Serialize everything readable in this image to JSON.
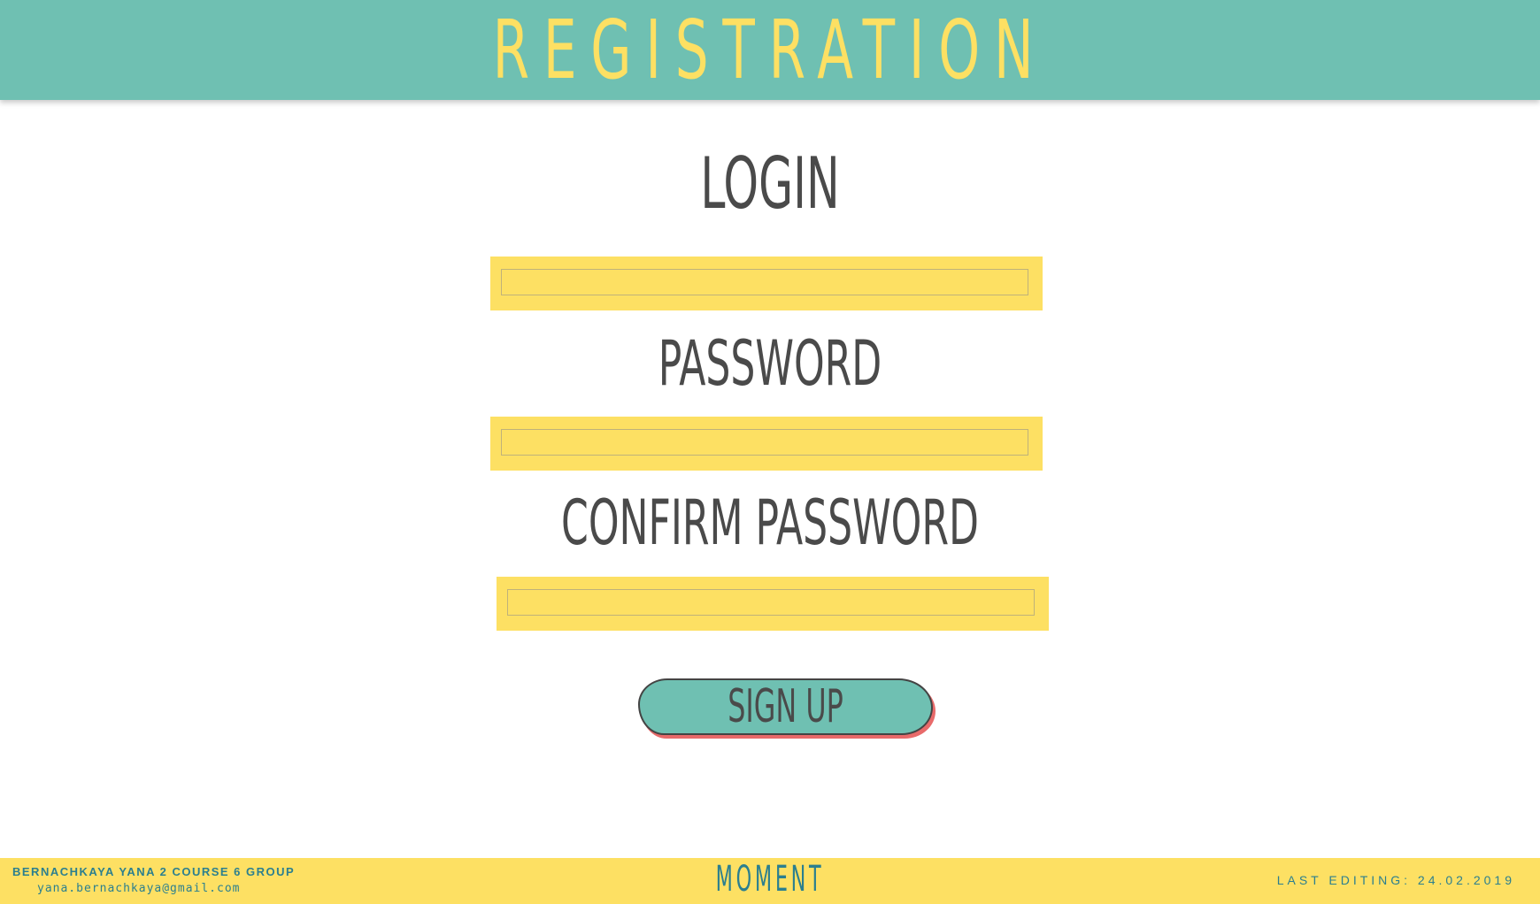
{
  "header": {
    "title": "REGISTRATION"
  },
  "form": {
    "login_label": "LOGIN",
    "login_value": "",
    "password_label": "PASSWORD",
    "password_value": "",
    "confirm_label": "CONFIRM PASSWORD",
    "confirm_value": "",
    "submit_label": "SIGN UP"
  },
  "footer": {
    "author": "BERNACHKAYA YANA 2 COURSE 6 GROUP",
    "email": "yana.bernachkaya@gmail.com",
    "brand": "MOMENT",
    "last_edit": "LAST EDITING: 24.02.2019"
  },
  "colors": {
    "teal": "#6fc0b2",
    "yellow": "#fde063",
    "text_dark": "#4a4a4a",
    "footer_text": "#2b7f8f",
    "button_shadow": "#e86a6a"
  }
}
